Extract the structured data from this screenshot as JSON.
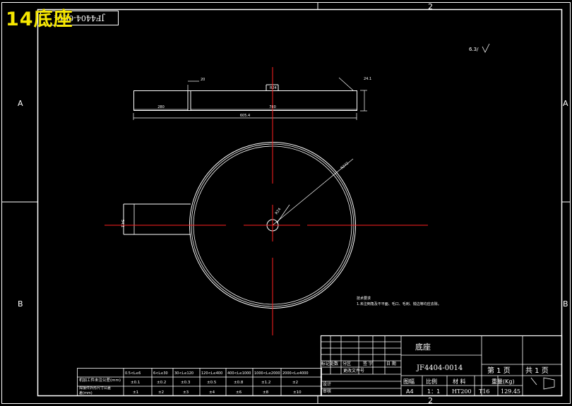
{
  "overlay_title": "14底座",
  "sheet": {
    "zone_cols": [
      "2"
    ],
    "zone_rows": [
      "A",
      "B"
    ],
    "stamp": "JF4404-0014"
  },
  "part": {
    "dim_length": "605.4",
    "dim_hole": "20",
    "dim_mid": "780",
    "dim_left": "280",
    "dim_thick": "24.1",
    "dim_radius": "R272",
    "dim_center": "R24",
    "dim_side": "54.1"
  },
  "notes": {
    "title": "技术要求",
    "line1": "1.未注倒角及不平面、毛口、毛刺、锐边等均应去除。"
  },
  "roughness": "6.3/",
  "title_block": {
    "part_name": "底座",
    "drawing_no": "JF4404-0014",
    "sheet_label": "第 1 页",
    "total_label": "共 1 页",
    "h_format": "图幅",
    "h_scale": "比例",
    "h_material": "材   料",
    "h_weight": "重量(Kg)",
    "v_format": "A4",
    "v_scale": "1：1",
    "v_material": "HT200",
    "v_material2": "T16",
    "v_weight": "129.45",
    "rev_marks": "标记处数",
    "rev_zone": "分区",
    "rev_doc": "更改文件号",
    "rev_sign": "签 字",
    "rev_date": "日 期",
    "role_design": "设计",
    "role_check": "审核"
  },
  "tolerance": {
    "row1_label": "机加工件未注公差(mm)",
    "row2_label": "焊接件外形尺寸公差",
    "row2_label_b": "差(mm)",
    "ranges": [
      "0.5<L≤6",
      "6<L≤30",
      "30<L≤120",
      "120<L≤400",
      "400<L≤1000",
      "1000<L≤2000",
      "2000<L≤4000"
    ],
    "values1": [
      "±0.1",
      "±0.2",
      "±0.3",
      "±0.5",
      "±0.8",
      "±1.2",
      "±2"
    ],
    "values2": [
      "±1",
      "±2",
      "±3",
      "±4",
      "±6",
      "±8",
      "±10"
    ]
  }
}
